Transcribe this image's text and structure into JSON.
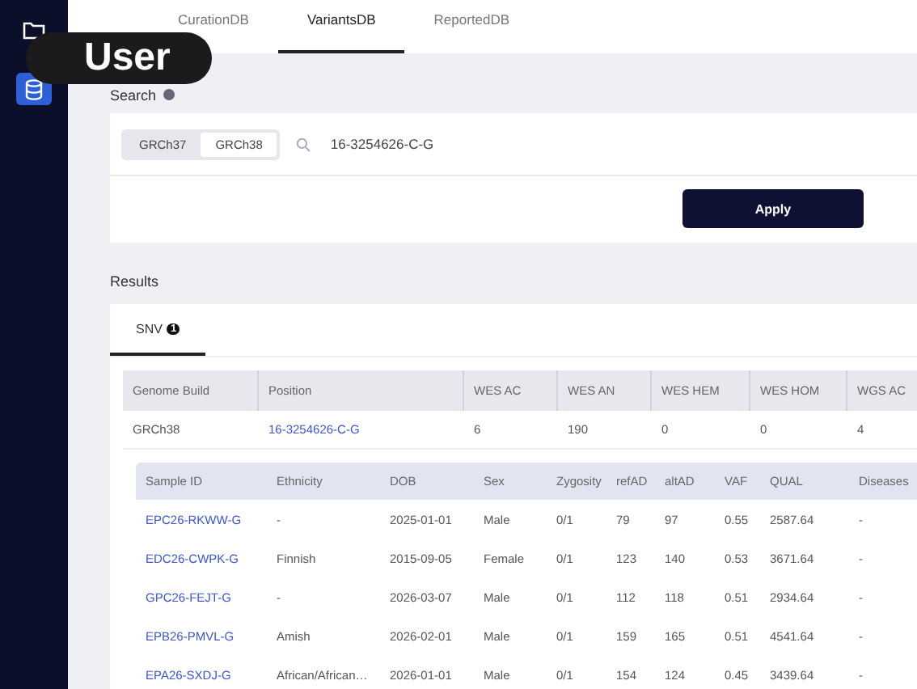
{
  "overlay_badge": "User",
  "sidebar": {
    "items": [
      {
        "selected": false
      },
      {
        "selected": true
      }
    ]
  },
  "tabs": [
    {
      "label": "CurationDB",
      "selected": false
    },
    {
      "label": "VariantsDB",
      "selected": true
    },
    {
      "label": "ReportedDB",
      "selected": false
    }
  ],
  "search": {
    "label": "Search",
    "builds": [
      {
        "label": "GRCh37",
        "selected": false
      },
      {
        "label": "GRCh38",
        "selected": true
      }
    ],
    "query": "16-3254626-C-G",
    "apply": "Apply"
  },
  "results": {
    "label": "Results",
    "tabs": [
      {
        "label": "SNV",
        "count": "1",
        "selected": true
      }
    ],
    "table": {
      "columns": [
        "Genome Build",
        "Position",
        "WES AC",
        "WES AN",
        "WES HEM",
        "WES HOM",
        "WGS AC"
      ],
      "rows": [
        [
          "GRCh38",
          "16-3254626-C-G",
          "6",
          "190",
          "0",
          "0",
          "4"
        ]
      ]
    },
    "samples": {
      "columns": [
        "Sample ID",
        "Ethnicity",
        "DOB",
        "Sex",
        "Zygosity",
        "refAD",
        "altAD",
        "VAF",
        "QUAL",
        "Diseases"
      ],
      "rows": [
        [
          "EPC26-RKWW-G",
          "-",
          "2025-01-01",
          "Male",
          "0/1",
          "79",
          "97",
          "0.55",
          "2587.64",
          "-"
        ],
        [
          "EDC26-CWPK-G",
          "Finnish",
          "2015-09-05",
          "Female",
          "0/1",
          "123",
          "140",
          "0.53",
          "3671.64",
          "-"
        ],
        [
          "GPC26-FEJT-G",
          "-",
          "2026-03-07",
          "Male",
          "0/1",
          "112",
          "118",
          "0.51",
          "2934.64",
          "-"
        ],
        [
          "EPB26-PMVL-G",
          "Amish",
          "2026-02-01",
          "Male",
          "0/1",
          "159",
          "165",
          "0.51",
          "4541.64",
          "-"
        ],
        [
          "EPA26-SXDJ-G",
          "African/African…",
          "2026-01-01",
          "Male",
          "0/1",
          "154",
          "124",
          "0.45",
          "3439.64",
          "-"
        ]
      ]
    }
  }
}
